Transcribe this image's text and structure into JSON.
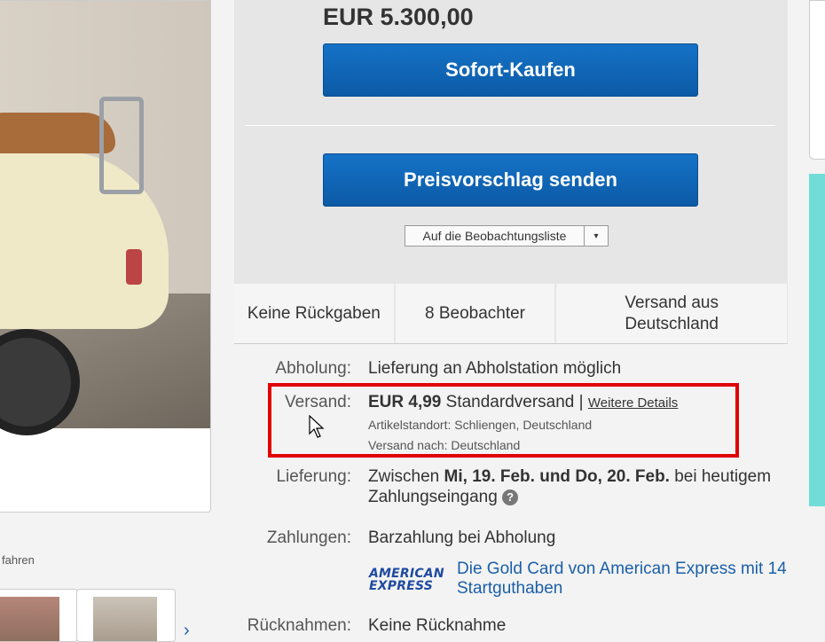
{
  "gallery": {
    "caption": "fahren",
    "next_arrow": "›"
  },
  "buybox": {
    "price": "EUR 5.300,00",
    "buy_now_label": "Sofort-Kaufen",
    "offer_label": "Preisvorschlag senden",
    "watchlist_label": "Auf die Beobachtungsliste",
    "watchlist_dropdown_icon": "▾",
    "info_cells": [
      {
        "text": "Keine Rückgaben"
      },
      {
        "text": "8 Beobachter"
      },
      {
        "text": "Versand aus Deutschland"
      }
    ]
  },
  "details": {
    "pickup_label": "Abholung:",
    "pickup_value": "Lieferung an Abholstation möglich",
    "shipping_label": "Versand:",
    "shipping_price": "EUR 4,99",
    "shipping_method": "Standardversand |",
    "shipping_link": "Weitere Details",
    "item_location_label": "Artikelstandort:",
    "item_location_value": "Schliengen, Deutschland",
    "ships_to_label": "Versand nach:",
    "ships_to_value": "Deutschland",
    "delivery_label": "Lieferung:",
    "delivery_prefix": "Zwischen",
    "delivery_dates": "Mi, 19. Feb. und Do, 20. Feb.",
    "delivery_suffix": "bei heutigem",
    "delivery_line2": "Zahlungseingang",
    "help_icon": "?",
    "payments_label": "Zahlungen:",
    "payments_value": "Barzahlung bei Abholung",
    "amex_logo_line1": "AMERICAN",
    "amex_logo_line2": "EXPRESS",
    "amex_offer_line1": "Die Gold Card von American Express mit 14",
    "amex_offer_line2": "Startguthaben",
    "returns_label": "Rücknahmen:",
    "returns_value": "Keine Rücknahme"
  },
  "colors": {
    "button_blue": "#0c5aa6",
    "highlight_red": "#e00000",
    "link_blue": "#1b5fa8",
    "teal_accent": "#72dcd8"
  }
}
